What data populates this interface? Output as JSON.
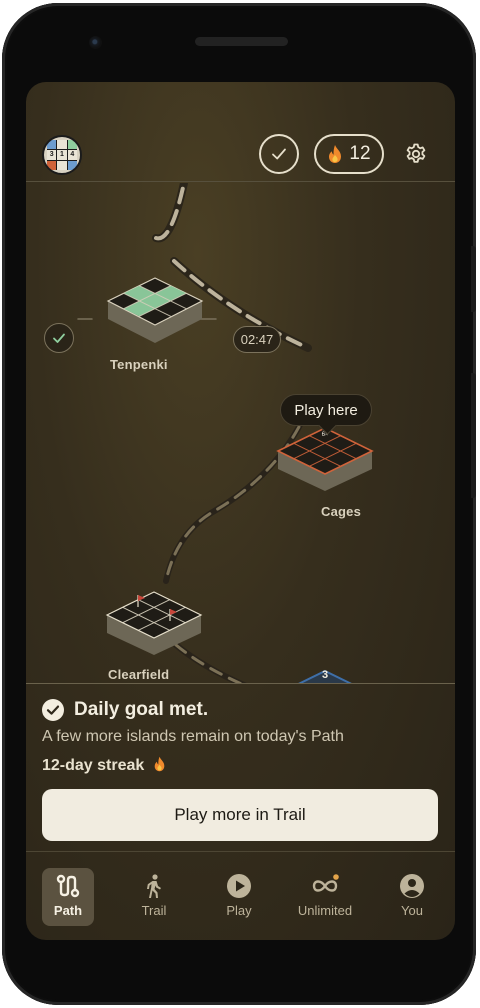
{
  "header": {
    "logo_digits": [
      "3",
      "1",
      "4"
    ],
    "streak_count": "12"
  },
  "islands": [
    {
      "name": "Tenpenki",
      "time": "02:47",
      "status": "completed"
    },
    {
      "name": "Cages",
      "tooltip": "Play here",
      "status": "current"
    },
    {
      "name": "Clearfield",
      "status": "upcoming"
    },
    {
      "badge": "3",
      "status": "upcoming"
    }
  ],
  "panel": {
    "title": "Daily goal met.",
    "subtitle": "A few more islands remain on today's Path",
    "streak_text": "12-day streak",
    "cta_label": "Play more in Trail"
  },
  "tabs": [
    {
      "label": "Path",
      "icon": "path-icon",
      "active": true
    },
    {
      "label": "Trail",
      "icon": "walker-icon",
      "active": false
    },
    {
      "label": "Play",
      "icon": "play-icon",
      "active": false
    },
    {
      "label": "Unlimited",
      "icon": "infinity-icon",
      "active": false,
      "has_dot": true
    },
    {
      "label": "You",
      "icon": "profile-icon",
      "active": false
    }
  ],
  "colors": {
    "background": "#362e1d",
    "cream": "#f1ece0",
    "completed_green": "#8fcf9f",
    "current_orange": "#d0633a",
    "flag_red": "#c9463a",
    "badge_blue": "#3f6fa8",
    "streak_dot": "#e3a44a"
  }
}
